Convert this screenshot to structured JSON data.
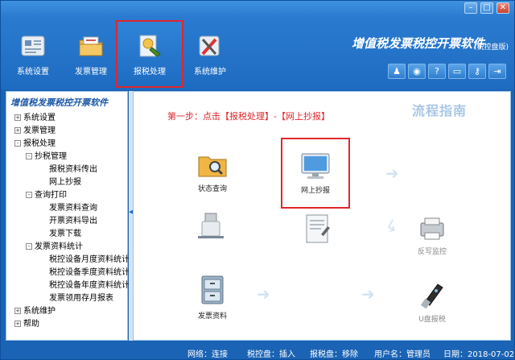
{
  "window": {
    "controls": {
      "minimize": "–",
      "maximize": "□",
      "close": "✕"
    }
  },
  "app": {
    "title": "增值税发票税控开票软件",
    "subtitle": "(税控盘版)"
  },
  "toolbar": {
    "items": [
      {
        "label": "系统设置",
        "icon": "system-settings-icon"
      },
      {
        "label": "发票管理",
        "icon": "invoice-folder-icon"
      },
      {
        "label": "报税处理",
        "icon": "tax-filing-icon",
        "active": true
      },
      {
        "label": "系统维护",
        "icon": "tools-icon"
      }
    ],
    "mini_buttons": [
      {
        "icon": "user-icon",
        "glyph": "♟"
      },
      {
        "icon": "globe-icon",
        "glyph": "◉"
      },
      {
        "icon": "help-icon",
        "glyph": "?"
      },
      {
        "icon": "window-icon",
        "glyph": "▭"
      },
      {
        "icon": "key-icon",
        "glyph": "⚷"
      },
      {
        "icon": "exit-icon",
        "glyph": "⇥"
      }
    ]
  },
  "sidebar": {
    "title": "增值税发票税控开票软件",
    "tree": [
      {
        "label": "系统设置",
        "exp": "+"
      },
      {
        "label": "发票管理",
        "exp": "+"
      },
      {
        "label": "报税处理",
        "exp": "-"
      },
      {
        "label": "抄税管理",
        "exp": "-"
      },
      {
        "label": "报税资料传出"
      },
      {
        "label": "网上抄报"
      },
      {
        "label": "查询打印",
        "exp": "-"
      },
      {
        "label": "发票资料查询"
      },
      {
        "label": "开票资料导出"
      },
      {
        "label": "发票下载"
      },
      {
        "label": "发票资料统计",
        "exp": "-"
      },
      {
        "label": "税控设备月度资料统计"
      },
      {
        "label": "税控设备季度资料统计"
      },
      {
        "label": "税控设备年度资料统计"
      },
      {
        "label": "发票领用存月报表"
      },
      {
        "label": "系统维护",
        "exp": "+"
      },
      {
        "label": "帮助",
        "exp": "+"
      }
    ]
  },
  "main": {
    "step_text": "第一步：点击【报税处理】-【网上抄报】",
    "guide_title": "流程指南",
    "nodes": [
      {
        "label": "状态查询",
        "icon": "folder-search-icon"
      },
      {
        "label": "网上抄报",
        "icon": "monitor-icon"
      },
      {
        "label": "",
        "icon": "usb-drive-icon"
      },
      {
        "label": "",
        "icon": "document-icon"
      },
      {
        "label": "反写监控",
        "icon": "printer-icon"
      },
      {
        "label": "发票资料",
        "icon": "file-cabinet-icon"
      },
      {
        "label": "U盘报税",
        "icon": "usb-key-icon"
      }
    ]
  },
  "status": {
    "network": "网络：连接",
    "tax_disk": "税控盘：插入",
    "filing_disk": "报税盘：移除",
    "user": "用户名：管理员",
    "date": "日期：2018-07-02"
  },
  "colors": {
    "accent_red": "#e0262b",
    "header_blue": "#1e6cc2",
    "guide_blue": "#a9c6e6"
  }
}
